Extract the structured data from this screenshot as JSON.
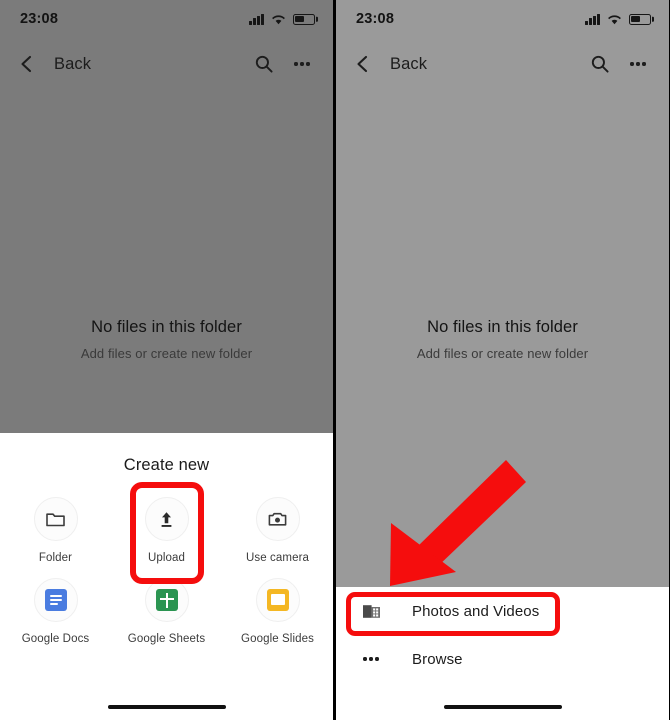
{
  "status_bar": {
    "time": "23:08",
    "signal_icon": "cellular-signal-icon",
    "wifi_icon": "wifi-icon",
    "battery_icon": "battery-icon"
  },
  "app_bar": {
    "back_icon": "chevron-left-icon",
    "back_label": "Back",
    "search_icon": "search-icon",
    "overflow_icon": "more-options-icon"
  },
  "empty_state": {
    "title": "No files in this folder",
    "subtitle": "Add files or create new folder"
  },
  "left_panel": {
    "sheet": {
      "title": "Create new",
      "items": [
        {
          "label": "Folder",
          "icon": "folder-icon"
        },
        {
          "label": "Upload",
          "icon": "upload-icon",
          "highlighted": true
        },
        {
          "label": "Use camera",
          "icon": "camera-icon"
        },
        {
          "label": "Google Docs",
          "icon": "google-docs-icon"
        },
        {
          "label": "Google Sheets",
          "icon": "google-sheets-icon"
        },
        {
          "label": "Google Slides",
          "icon": "google-slides-icon"
        }
      ]
    }
  },
  "right_panel": {
    "sheet": {
      "items": [
        {
          "label": "Photos and Videos",
          "icon": "photos-and-videos-icon",
          "highlighted": true
        },
        {
          "label": "Browse",
          "icon": "more-horizontal-icon",
          "highlighted": false
        }
      ]
    },
    "annotation": {
      "arrow_icon": "red-pointer-arrow-icon",
      "arrow_direction": "down-left"
    }
  },
  "colors": {
    "highlight": "#f50d0d",
    "scrim_left": "#7b7b7b",
    "scrim_right": "#9a9a9a",
    "sheet_background": "#ffffff",
    "docs_blue": "#4a7ce0",
    "sheets_green": "#2a9451",
    "slides_yellow": "#f4b723"
  }
}
